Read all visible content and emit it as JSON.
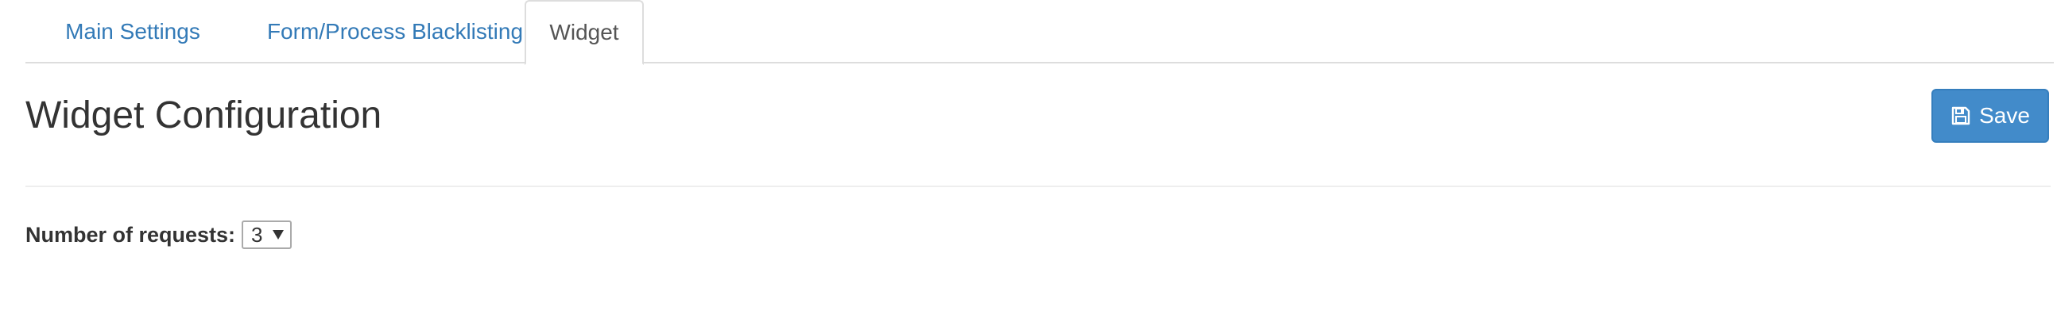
{
  "tabs": [
    {
      "label": "Main Settings",
      "active": false
    },
    {
      "label": "Form/Process Blacklisting",
      "active": false
    },
    {
      "label": "Widget",
      "active": true
    }
  ],
  "header": {
    "title": "Widget Configuration",
    "save_label": "Save"
  },
  "settings": {
    "requests_label": "Number of requests:",
    "requests_value": "3"
  },
  "colors": {
    "link": "#337ab7",
    "primary_button": "#428bca",
    "border": "#dddddd"
  },
  "icons": {
    "save": "floppy-disk-icon",
    "dropdown": "caret-down-icon"
  }
}
